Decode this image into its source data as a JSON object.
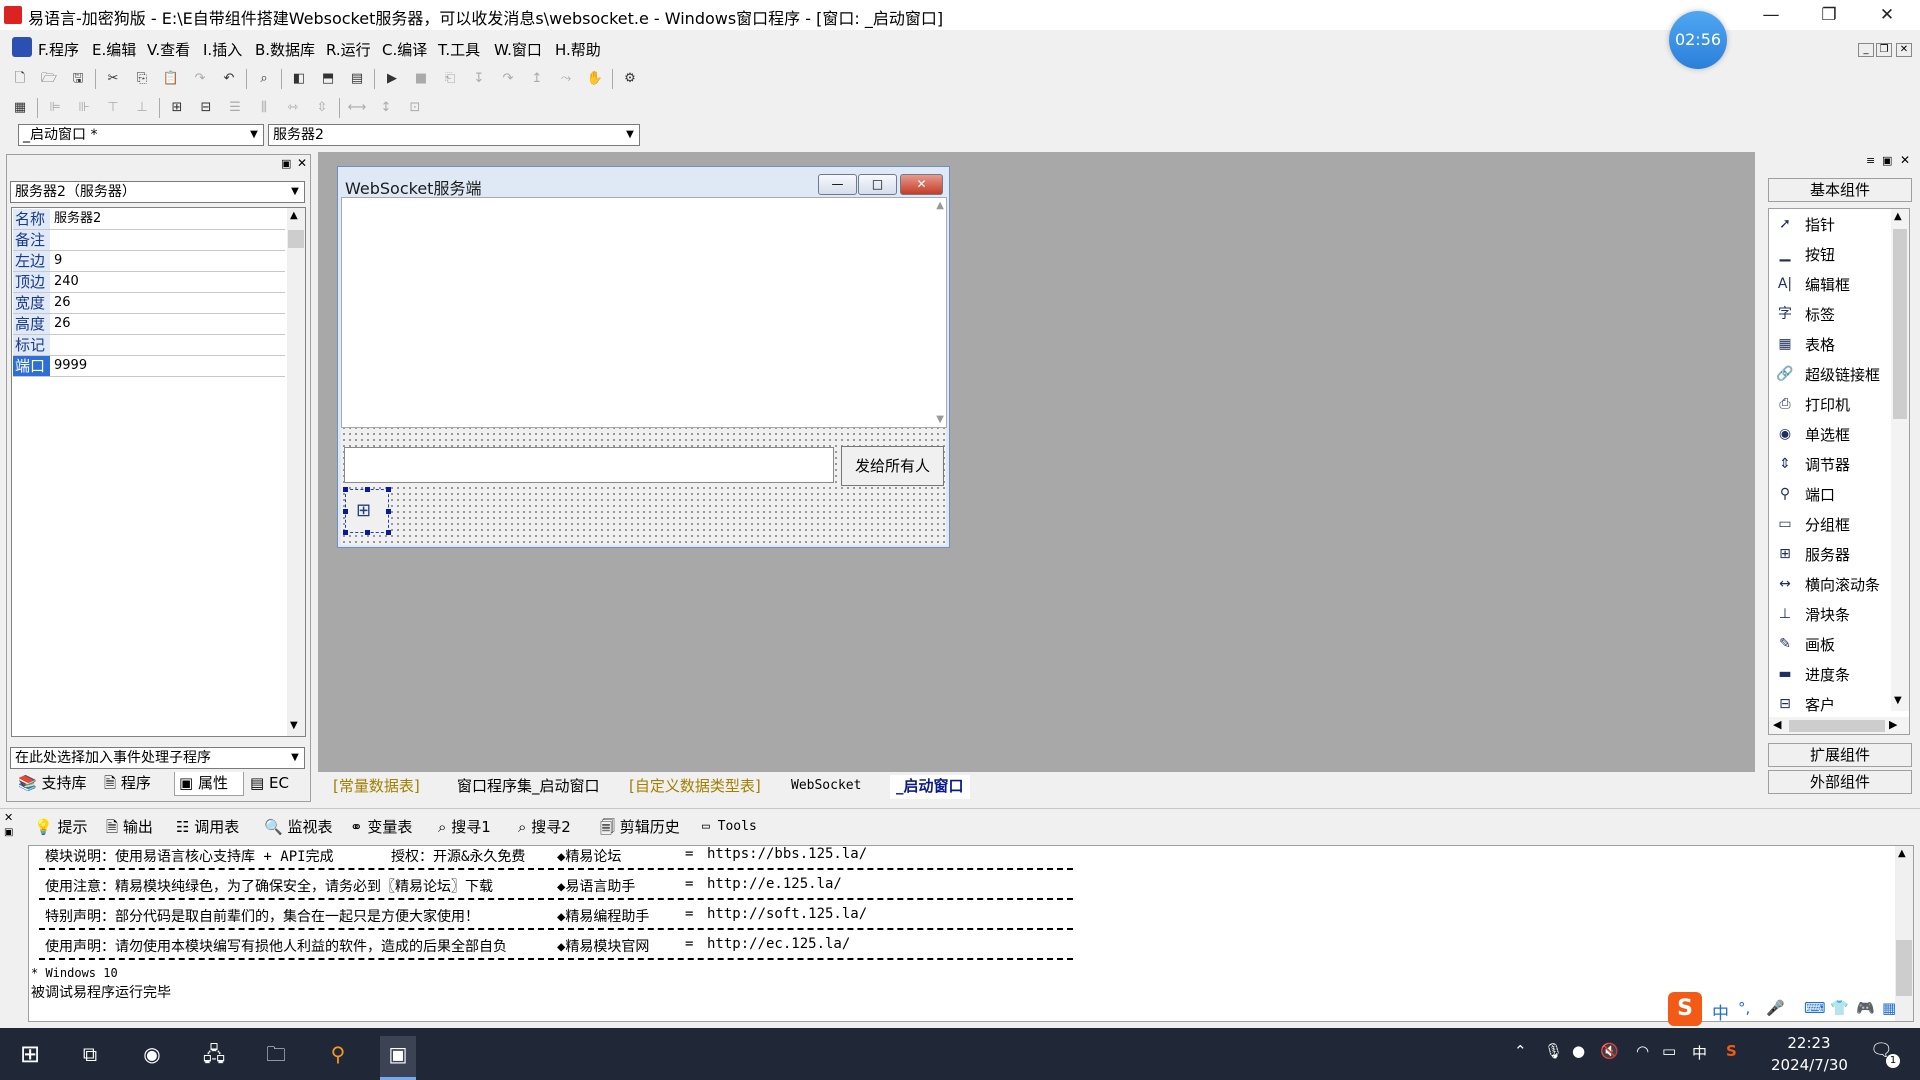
{
  "window": {
    "title": "易语言-加密狗版 - E:\\E自带组件搭建Websocket服务器，可以收发消息s\\websocket.e - Windows窗口程序 - [窗口: _启动窗口]",
    "minimize": "—",
    "restore": "❐",
    "close": "✕"
  },
  "timer": "02:56",
  "menu": [
    "F.程序",
    "E.编辑",
    "V.查看",
    "I.插入",
    "B.数据库",
    "R.运行",
    "C.编译",
    "T.工具",
    "W.窗口",
    "H.帮助"
  ],
  "mdi": {
    "minimize": "_",
    "restore": "❐",
    "close": "✕"
  },
  "selectors": {
    "window_combo": "_启动窗口 *",
    "component_combo": "服务器2"
  },
  "left_panel": {
    "object_combo": "服务器2（服务器）",
    "properties": [
      {
        "key": "名称",
        "value": "服务器2"
      },
      {
        "key": "备注",
        "value": ""
      },
      {
        "key": "左边",
        "value": "9"
      },
      {
        "key": "顶边",
        "value": "240"
      },
      {
        "key": "宽度",
        "value": "26"
      },
      {
        "key": "高度",
        "value": "26"
      },
      {
        "key": "标记",
        "value": ""
      },
      {
        "key": "端口",
        "value": "9999"
      }
    ],
    "event_combo": "在此处选择加入事件处理子程序",
    "tabs": [
      "支持库",
      "程序",
      "属性",
      "EC"
    ]
  },
  "form": {
    "title": "WebSocket服务端",
    "send_button": "发给所有人",
    "min": "—",
    "max": "□",
    "close": "✕"
  },
  "doc_tabs": [
    "[常量数据表]",
    "窗口程序集_启动窗口",
    "[自定义数据类型表]",
    "WebSocket",
    "_启动窗口"
  ],
  "right_panel": {
    "basic_group": "基本组件",
    "components": [
      {
        "label": "指针",
        "icon": "pointer-icon",
        "glyph": "➚"
      },
      {
        "label": "按钮",
        "icon": "button-icon",
        "glyph": "▁"
      },
      {
        "label": "编辑框",
        "icon": "editbox-icon",
        "glyph": "A|"
      },
      {
        "label": "标签",
        "icon": "label-icon",
        "glyph": "字"
      },
      {
        "label": "表格",
        "icon": "grid-icon",
        "glyph": "▦"
      },
      {
        "label": "超级链接框",
        "icon": "hyperlink-icon",
        "glyph": "🔗"
      },
      {
        "label": "打印机",
        "icon": "printer-icon",
        "glyph": "⎙"
      },
      {
        "label": "单选框",
        "icon": "radio-icon",
        "glyph": "◉"
      },
      {
        "label": "调节器",
        "icon": "spinner-icon",
        "glyph": "⇕"
      },
      {
        "label": "端口",
        "icon": "port-icon",
        "glyph": "⚲"
      },
      {
        "label": "分组框",
        "icon": "groupbox-icon",
        "glyph": "▭"
      },
      {
        "label": "服务器",
        "icon": "server-icon",
        "glyph": "⊞"
      },
      {
        "label": "横向滚动条",
        "icon": "hscroll-icon",
        "glyph": "↔"
      },
      {
        "label": "滑块条",
        "icon": "slider-icon",
        "glyph": "⊥"
      },
      {
        "label": "画板",
        "icon": "canvas-icon",
        "glyph": "✎"
      },
      {
        "label": "进度条",
        "icon": "progress-icon",
        "glyph": "▬"
      },
      {
        "label": "客户",
        "icon": "client-icon",
        "glyph": "⊟"
      }
    ],
    "ext_group": "扩展组件",
    "external_group": "外部组件"
  },
  "bottom_tabs": [
    "提示",
    "输出",
    "调用表",
    "监视表",
    "变量表",
    "搜寻1",
    "搜寻2",
    "剪辑历史",
    "Tools"
  ],
  "console": {
    "rows": [
      {
        "left": "模块说明：使用易语言核心支持库 + API完成",
        "mid": "授权：开源&永久免费",
        "site": "◆精易论坛",
        "eq": "=",
        "url": "https://bbs.125.la/"
      },
      {
        "left": "使用注意：精易模块纯绿色，为了确保安全，请务必到〖精易论坛〗下载",
        "mid": "",
        "site": "◆易语言助手",
        "eq": "=",
        "url": "http://e.125.la/"
      },
      {
        "left": "特别声明：部分代码是取自前辈们的，集合在一起只是方便大家使用！",
        "mid": "",
        "site": "◆精易编程助手",
        "eq": "=",
        "url": "http://soft.125.la/"
      },
      {
        "left": "使用声明：请勿使用本模块编写有损他人利益的软件，造成的后果全部自负",
        "mid": "",
        "site": "◆精易模块官网",
        "eq": "=",
        "url": "http://ec.125.la/"
      }
    ],
    "os_line": "* Windows 10",
    "done_line": "被调试易程序运行完毕"
  },
  "ime": [
    "中",
    "°,",
    "🎤",
    "⌨",
    "👕",
    "🎮",
    "▦"
  ],
  "taskbar": {
    "tray_lang": "中",
    "time": "22:23",
    "date": "2024/7/30",
    "notification_count": "1"
  }
}
